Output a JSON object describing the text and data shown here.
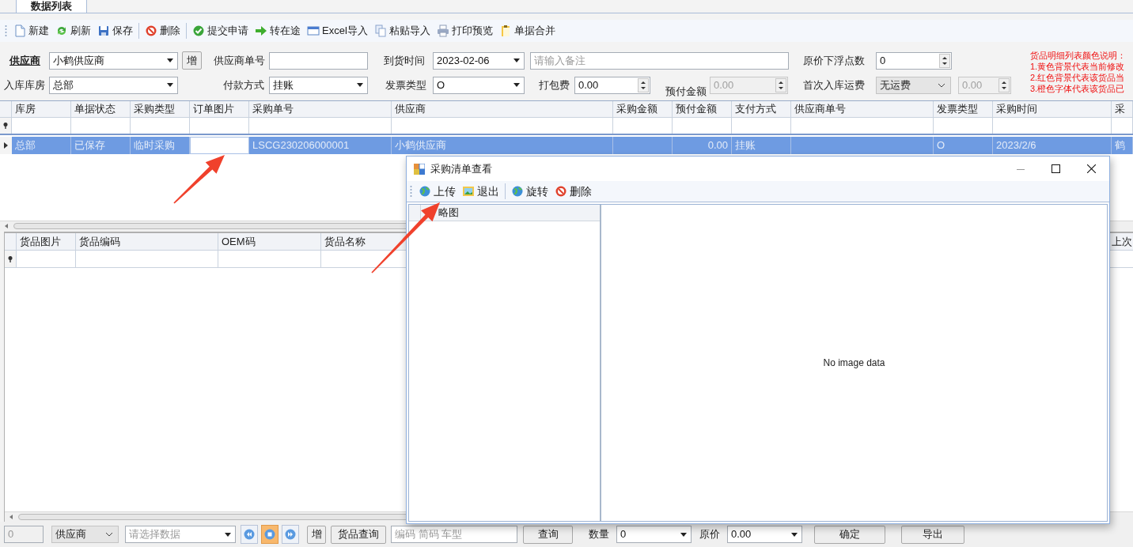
{
  "tab": {
    "label": "数据列表",
    "selected": true
  },
  "toolbar_groups": [
    [
      {
        "label": "新建"
      },
      {
        "label": "刷新"
      },
      {
        "label": "保存"
      }
    ],
    [
      {
        "label": "删除"
      }
    ],
    [
      {
        "label": "提交申请"
      },
      {
        "label": "转在途"
      },
      {
        "label": "Excel导入"
      },
      {
        "label": "粘贴导入"
      },
      {
        "label": "打印预览"
      },
      {
        "label": "单据合并"
      }
    ]
  ],
  "form_rows": [
    [
      {
        "kind": "link_label",
        "text": "供应商"
      },
      {
        "kind": "select",
        "value": "小鹤供应商"
      },
      {
        "kind": "button",
        "label": "增"
      },
      {
        "kind": "label",
        "text": "供应商单号"
      },
      {
        "kind": "text"
      },
      {
        "kind": "label",
        "text": "到货时间"
      },
      {
        "kind": "select",
        "value": "2023-02-06"
      },
      {
        "kind": "text",
        "placeholder": "请输入备注"
      },
      {
        "kind": "label",
        "text": "原价下浮点数"
      },
      {
        "kind": "spin",
        "value": "0",
        "disabled": false
      }
    ],
    [
      {
        "kind": "label",
        "text": "入库库房"
      },
      {
        "kind": "select",
        "value": "总部"
      },
      {
        "kind": "label",
        "text": "付款方式"
      },
      {
        "kind": "select",
        "value": "挂账"
      },
      {
        "kind": "label",
        "text": "发票类型"
      },
      {
        "kind": "select",
        "value": "O"
      },
      {
        "kind": "label",
        "text": "打包费"
      },
      {
        "kind": "spin",
        "value": "0.00",
        "disabled": false
      },
      {
        "kind": "label",
        "text": "预付金额"
      },
      {
        "kind": "spin",
        "value": "0.00",
        "disabled": true
      },
      {
        "kind": "label",
        "text": "首次入库运费"
      },
      {
        "kind": "dropdown",
        "value": "无运费"
      },
      {
        "kind": "spin",
        "value": "0.00",
        "disabled": true
      }
    ]
  ],
  "color_legend": [
    "货品明细列表颜色说明：",
    "1.黄色背景代表当前修改",
    "2.红色背景代表该货品当",
    "3.橙色字体代表该货品已"
  ],
  "order_grid": {
    "columns": [
      {
        "label": "库房",
        "kind": "text"
      },
      {
        "label": "单据状态",
        "kind": "text"
      },
      {
        "label": "采购类型",
        "kind": "text"
      },
      {
        "label": "订单图片",
        "kind": "image"
      },
      {
        "label": "采购单号",
        "kind": "text"
      },
      {
        "label": "供应商",
        "kind": "text"
      },
      {
        "label": "采购金额",
        "kind": "number"
      },
      {
        "label": "预付金额",
        "kind": "number"
      },
      {
        "label": "支付方式",
        "kind": "text"
      },
      {
        "label": "供应商单号",
        "kind": "text"
      },
      {
        "label": "发票类型",
        "kind": "text"
      },
      {
        "label": "采购时间",
        "kind": "text"
      },
      {
        "label": "采",
        "kind": "text"
      }
    ],
    "rows": [
      {
        "selected": true,
        "cells": [
          "总部",
          "已保存",
          "临时采购",
          null,
          "LSCG230206000001",
          "小鹤供应商",
          null,
          "0.00",
          "挂账",
          null,
          "O",
          "2023/2/6",
          "鹤"
        ]
      }
    ]
  },
  "detail_grid": {
    "columns": [
      "货品图片",
      "货品编码",
      "OEM码",
      "货品名称",
      "上次"
    ]
  },
  "bottom_bar": [
    {
      "kind": "text",
      "value": "0",
      "disabled": true
    },
    {
      "kind": "dropdown",
      "value": "供应商"
    },
    {
      "kind": "select",
      "placeholder": "请选择数据"
    },
    {
      "kind": "nav",
      "selected": false
    },
    {
      "kind": "nav",
      "selected": true
    },
    {
      "kind": "nav",
      "selected": false
    },
    {
      "kind": "button",
      "label": "增"
    },
    {
      "kind": "button",
      "label": "货品查询"
    },
    {
      "kind": "text",
      "placeholder": "编码 简码 车型"
    },
    {
      "kind": "button",
      "label": "查询"
    },
    {
      "kind": "label",
      "text": "数量"
    },
    {
      "kind": "select",
      "value": "0"
    },
    {
      "kind": "label",
      "text": "原价"
    },
    {
      "kind": "select",
      "value": "0.00"
    },
    {
      "kind": "button",
      "label": "确定"
    },
    {
      "kind": "button",
      "label": "导出"
    }
  ],
  "dialog": {
    "title": "采购清单查看",
    "toolbar_groups": [
      [
        {
          "label": "上传"
        },
        {
          "label": "退出"
        }
      ],
      [
        {
          "label": "旋转"
        },
        {
          "label": "删除"
        }
      ]
    ],
    "thumbnail_header": "略图",
    "empty_message": "No image data"
  }
}
